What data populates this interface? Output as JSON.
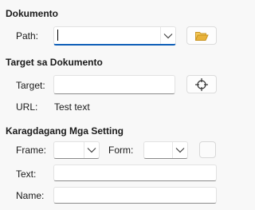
{
  "document_section": {
    "title": "Dokumento",
    "path_label": "Path:",
    "path_value": ""
  },
  "target_section": {
    "title": "Target sa Dokumento",
    "target_label": "Target:",
    "target_value": "",
    "url_label": "URL:",
    "url_value": "Test text"
  },
  "settings_section": {
    "title": "Karagdagang Mga Setting",
    "frame_label": "Frame:",
    "frame_value": "",
    "form_label": "Form:",
    "form_value": "",
    "text_label": "Text:",
    "text_value": "",
    "name_label": "Name:",
    "name_value": ""
  },
  "icons": {
    "open_folder": "folder-open-icon",
    "target_picker": "crosshair-icon",
    "dropdown": "chevron-down-icon"
  },
  "colors": {
    "folder_yellow": "#e8b23a",
    "focus_accent": "#0f5fb8"
  }
}
